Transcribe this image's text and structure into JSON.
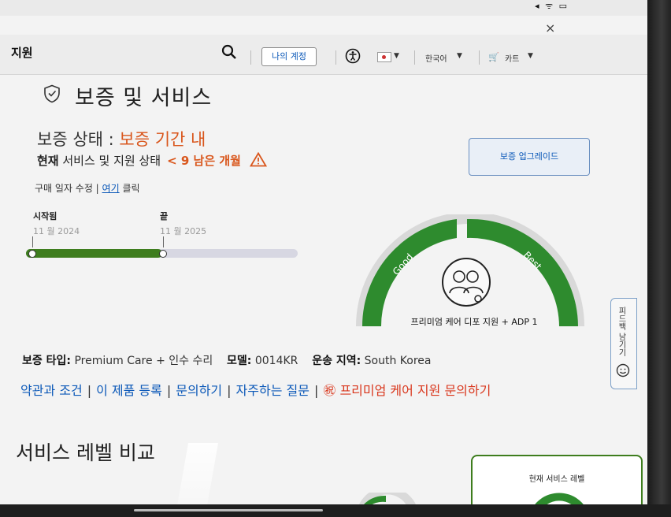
{
  "header": {
    "brand": "지원",
    "account_button": "나의 계정",
    "language": "한국어",
    "cart_label": "카트"
  },
  "page": {
    "title": "보증 및 서비스",
    "status_label": "보증 상태 : ",
    "status_value": "보증 기간 내",
    "current_bold": "현재",
    "current_text": " 서비스 및 지원 상태",
    "remaining": "< 9 남은 개월",
    "edit_text": "구매 일자 수정 | ",
    "edit_link": "여기",
    "edit_suffix": " 클릭",
    "upgrade_button": "보증 업그레이드"
  },
  "timeline": {
    "start_label": "시작됨",
    "start_date": "11 월 2024",
    "end_label": "끝",
    "end_date": "11 월 2025",
    "progress_fraction": 0.5
  },
  "gauge": {
    "left_label": "Good",
    "right_label": "Best",
    "plan_label": "프리미엄 케어 디포 지원 + ADP 1",
    "fill_color": "#2e8b2e"
  },
  "meta": {
    "type_label": "보증 타입:",
    "type_value": " Premium Care + 인수 수리",
    "model_label": "모델:",
    "model_value": " 0014KR",
    "region_label": "운송 지역:",
    "region_value": " South Korea"
  },
  "links": {
    "terms": "약관과 조건",
    "register": "이 제품 등록",
    "contact": "문의하기",
    "faq": "자주하는 질문",
    "premium_contact": "프리미엄 케어 지원 문의하기"
  },
  "compare": {
    "title": "서비스 레벨 비교",
    "current_card_label": "현재 서비스 레벨"
  },
  "feedback": {
    "label": "피드백 남기기"
  },
  "colors": {
    "accent_blue": "#0b58b8",
    "warning_orange": "#d9561c",
    "progress_green": "#3e7d1e"
  }
}
